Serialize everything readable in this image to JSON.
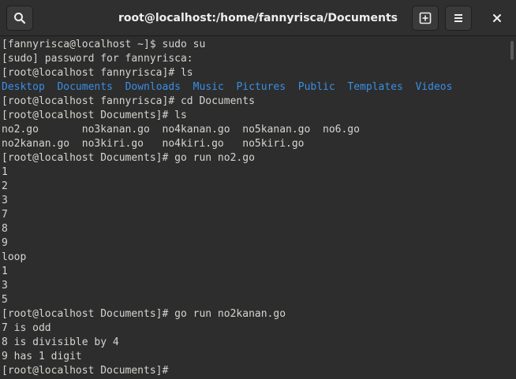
{
  "window": {
    "title": "root@localhost:/home/fannyrisca/Documents",
    "icons": {
      "search": "search-icon",
      "new_tab": "new-tab-icon",
      "menu": "hamburger-menu-icon",
      "close": "close-icon"
    }
  },
  "colors": {
    "background": "#2d2d2d",
    "text": "#d3d7cf",
    "directory": "#3a8ee6"
  },
  "terminal": {
    "lines": [
      "[fannyrisca@localhost ~]$ sudo su",
      "[sudo] password for fannyrisca:",
      "[root@localhost fannyrisca]# ls",
      "",
      "[root@localhost fannyrisca]# cd Documents",
      "[root@localhost Documents]# ls",
      "no2.go       no3kanan.go  no4kanan.go  no5kanan.go  no6.go",
      "no2kanan.go  no3kiri.go   no4kiri.go   no5kiri.go",
      "[root@localhost Documents]# go run no2.go",
      "1",
      "2",
      "3",
      "7",
      "8",
      "9",
      "loop",
      "1",
      "3",
      "5",
      "[root@localhost Documents]# go run no2kanan.go",
      "7 is odd",
      "8 is divisible by 4",
      "9 has 1 digit",
      "[root@localhost Documents]#"
    ],
    "directories": [
      "Desktop",
      "Documents",
      "Downloads",
      "Music",
      "Pictures",
      "Public",
      "Templates",
      "Videos"
    ]
  }
}
